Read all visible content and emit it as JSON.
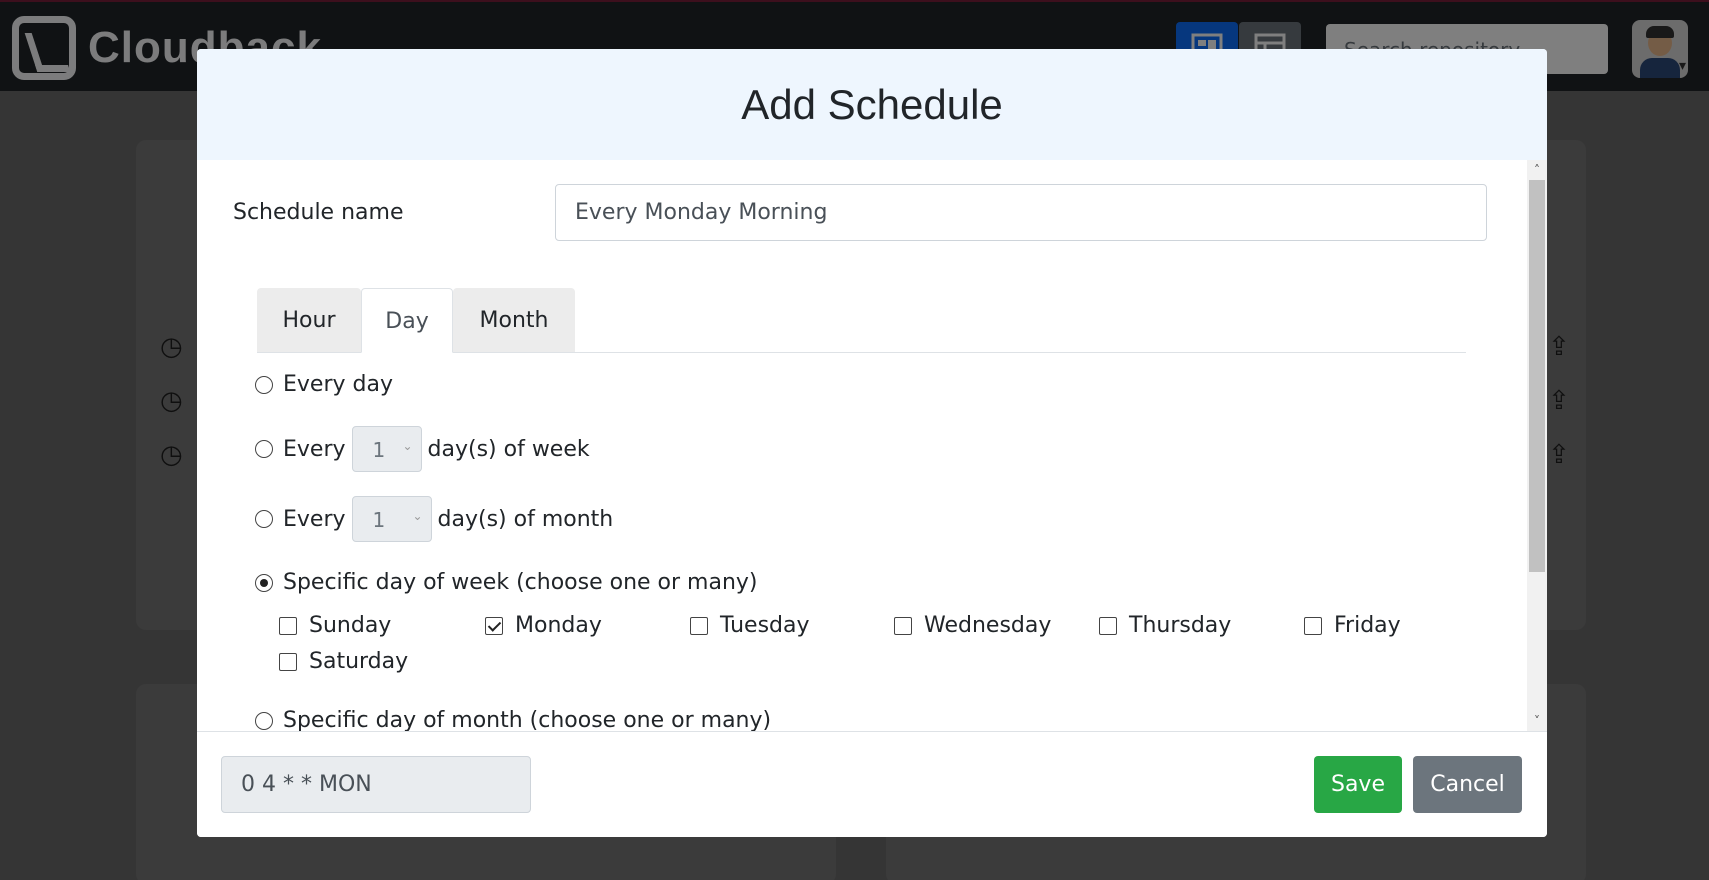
{
  "app": {
    "name": "Cloudback",
    "search_placeholder": "Search repository"
  },
  "modal": {
    "title": "Add Schedule",
    "schedule_name_label": "Schedule name",
    "schedule_name_value": "Every Monday Morning",
    "tabs": [
      "Hour",
      "Day",
      "Month"
    ],
    "active_tab": "Day",
    "options": {
      "every_day": "Every day",
      "every_word": "Every",
      "week_interval_value": "1",
      "week_suffix": "day(s) of week",
      "month_interval_value": "1",
      "month_suffix": "day(s) of month",
      "specific_week": "Specific day of week (choose one or many)",
      "specific_month": "Specific day of month (choose one or many)"
    },
    "weekdays": [
      {
        "label": "Sunday",
        "checked": false
      },
      {
        "label": "Monday",
        "checked": true
      },
      {
        "label": "Tuesday",
        "checked": false
      },
      {
        "label": "Wednesday",
        "checked": false
      },
      {
        "label": "Thursday",
        "checked": false
      },
      {
        "label": "Friday",
        "checked": false
      },
      {
        "label": "Saturday",
        "checked": false
      }
    ],
    "cron_expression": "0 4 * * MON",
    "save_label": "Save",
    "cancel_label": "Cancel"
  },
  "icons": {
    "clock": "clock-icon",
    "board_view": "board-view-icon",
    "table_view": "table-view-icon",
    "restore": "restore-icon"
  },
  "colors": {
    "save": "#28a745",
    "cancel": "#6c757d",
    "header_bg": "#eef6fe",
    "topbar": "#212529",
    "active_view": "#0d6efd"
  }
}
